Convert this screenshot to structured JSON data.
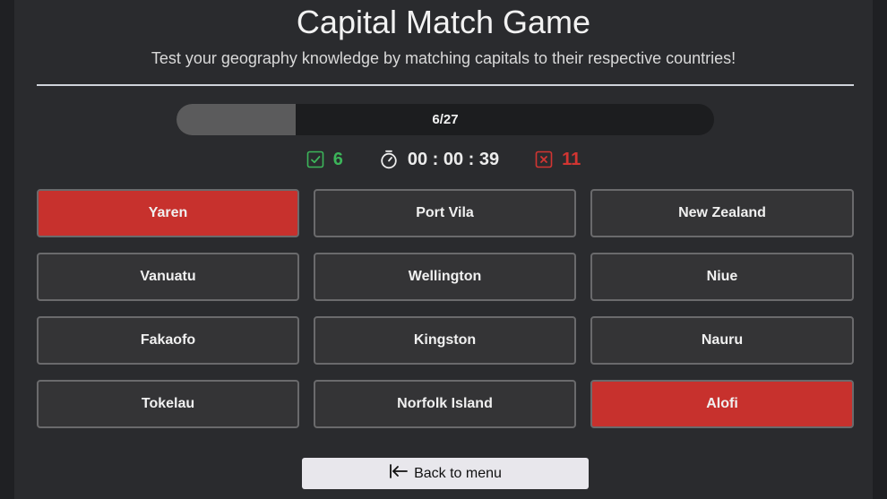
{
  "header": {
    "title": "Capital Match Game",
    "subtitle": "Test your geography knowledge by matching capitals to their respective countries!"
  },
  "progress": {
    "label": "6/27",
    "current": 6,
    "total": 27
  },
  "stats": {
    "correct": "6",
    "timer": "00 : 00 : 39",
    "wrong": "11",
    "correct_icon": "check-square-icon",
    "timer_icon": "stopwatch-icon",
    "wrong_icon": "x-square-icon"
  },
  "colors": {
    "correct": "#3cb55a",
    "wrong": "#d23532",
    "wrong_tile": "#c7312d",
    "tile": "#343436"
  },
  "tiles": [
    {
      "label": "Yaren",
      "state": "wrong"
    },
    {
      "label": "Port Vila",
      "state": "normal"
    },
    {
      "label": "New Zealand",
      "state": "normal"
    },
    {
      "label": "Vanuatu",
      "state": "normal"
    },
    {
      "label": "Wellington",
      "state": "normal"
    },
    {
      "label": "Niue",
      "state": "normal"
    },
    {
      "label": "Fakaofo",
      "state": "normal"
    },
    {
      "label": "Kingston",
      "state": "normal"
    },
    {
      "label": "Nauru",
      "state": "normal"
    },
    {
      "label": "Tokelau",
      "state": "normal"
    },
    {
      "label": "Norfolk Island",
      "state": "normal"
    },
    {
      "label": "Alofi",
      "state": "wrong"
    }
  ],
  "footer": {
    "back_label": "Back to menu",
    "back_icon": "arrow-left-to-bar-icon"
  }
}
